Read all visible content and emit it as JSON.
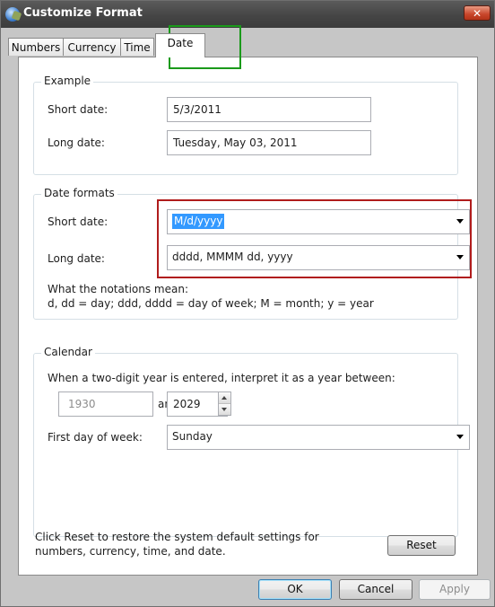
{
  "window": {
    "title": "Customize Format",
    "close_glyph": "✕",
    "icon": "globe-icon"
  },
  "tabs": [
    {
      "label": "Numbers",
      "active": false
    },
    {
      "label": "Currency",
      "active": false
    },
    {
      "label": "Time",
      "active": false
    },
    {
      "label": "Date",
      "active": true
    }
  ],
  "example": {
    "legend": "Example",
    "short_label": "Short date:",
    "short_value": "5/3/2011",
    "long_label": "Long date:",
    "long_value": "Tuesday, May 03, 2011"
  },
  "formats": {
    "legend": "Date formats",
    "short_label": "Short date:",
    "short_value": "M/d/yyyy",
    "long_label": "Long date:",
    "long_value": "dddd, MMMM dd, yyyy",
    "notation_title": "What the notations mean:",
    "notation_text": "d, dd = day;  ddd, dddd = day of week;  M = month;  y = year"
  },
  "calendar": {
    "legend": "Calendar",
    "two_digit_text": "When a two-digit year is entered, interpret it as a year between:",
    "year_from": "1930",
    "and_label": "and",
    "year_to": "2029",
    "first_day_label": "First day of week:",
    "first_day_value": "Sunday"
  },
  "reset": {
    "text": "Click Reset to restore the system default settings for numbers, currency, time, and date.",
    "button": "Reset"
  },
  "footer": {
    "ok": "OK",
    "cancel": "Cancel",
    "apply": "Apply"
  },
  "colors": {
    "tab_highlight": "#1a9a1a",
    "format_highlight": "#b01c1c",
    "selection": "#3399ff"
  }
}
